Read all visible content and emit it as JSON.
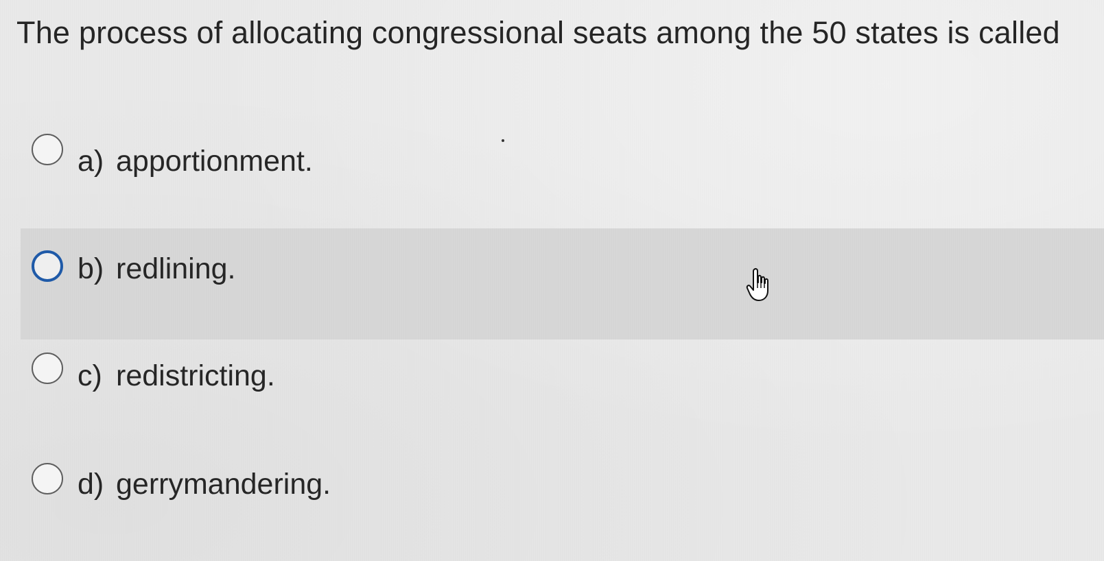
{
  "question": {
    "text": "The process of allocating congressional seats among the 50 states is called"
  },
  "options": [
    {
      "letter": "a)",
      "text": "apportionment.",
      "selected": false,
      "hovered": false
    },
    {
      "letter": "b)",
      "text": "redlining.",
      "selected": false,
      "hovered": true
    },
    {
      "letter": "c)",
      "text": "redistricting.",
      "selected": false,
      "hovered": false
    },
    {
      "letter": "d)",
      "text": "gerrymandering.",
      "selected": false,
      "hovered": false
    }
  ],
  "cursor": {
    "icon": "hand-pointer-icon"
  },
  "colors": {
    "hover_row": "#d7d7d7",
    "radio_hover_border": "#1f5aa8",
    "radio_border": "#5e5e5e",
    "text": "#262626"
  }
}
